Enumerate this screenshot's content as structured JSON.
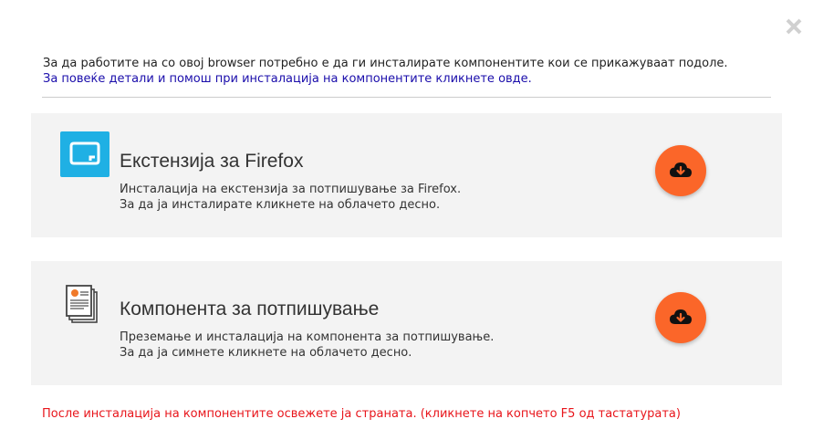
{
  "intro": {
    "text": "За да работите на со овој browser потребно е да ги инсталирате компонентите кои се прикажуваат подоле.",
    "help_link": "За повеќе детали и помош при инсталација на компонентите кликнете овде."
  },
  "cards": [
    {
      "icon": "firefox-extension-icon",
      "title": "Екстензија за Firefox",
      "desc_line1": "Инсталација на екстензија за потпишување за Firefox.",
      "desc_line2": "За да ја инсталирате кликнете на облачето десно."
    },
    {
      "icon": "documents-icon",
      "title": "Компонента за потпишување",
      "desc_line1": "Преземање и инсталација на компонента за потпишување.",
      "desc_line2": "За да ја симнете кликнете на облачето десно."
    }
  ],
  "footer_note": "После инсталација на компонентите освежете ја страната. (кликнете на копчето F5 од тастатурата)",
  "colors": {
    "accent": "#fb6629",
    "link": "#1a0dab",
    "warning": "#e8151b",
    "card_bg": "#f3f3f3",
    "firefox_icon_bg": "#1fb0e4"
  }
}
